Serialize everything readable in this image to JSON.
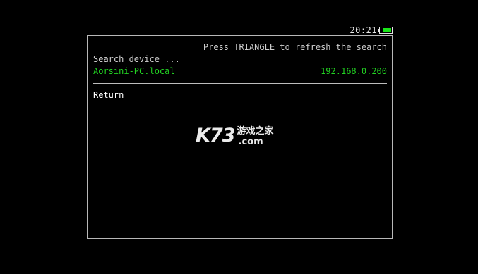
{
  "status": {
    "time": "20:21",
    "battery_level": 0.8,
    "battery_color": "#19e619"
  },
  "panel": {
    "hint": "Press TRIANGLE to refresh the search",
    "search_label": "Search device ...",
    "devices": [
      {
        "name": "Aorsini-PC.local",
        "ip": "192.168.0.200"
      }
    ],
    "return_label": "Return",
    "device_text_color": "#22d422"
  },
  "watermark": {
    "mark": "K73",
    "cn": "游戏之家",
    "domain": ".com"
  }
}
